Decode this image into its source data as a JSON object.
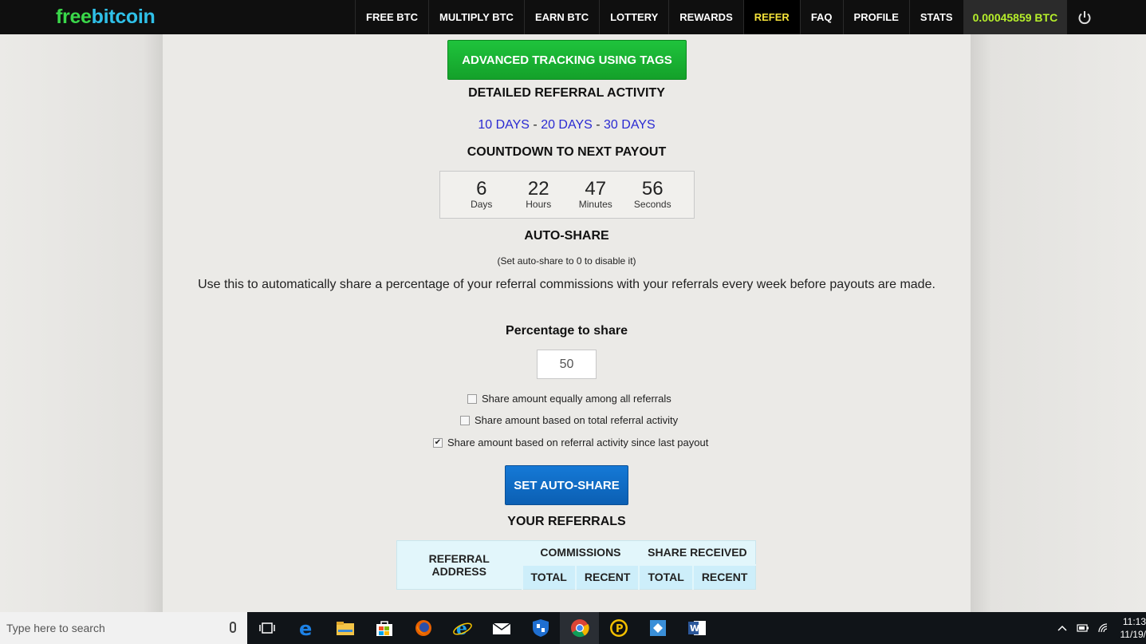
{
  "nav": {
    "logo_part1": "free",
    "logo_part2": "bitcoin",
    "items": [
      "FREE BTC",
      "MULTIPLY BTC",
      "EARN BTC",
      "LOTTERY",
      "REWARDS",
      "REFER",
      "FAQ",
      "PROFILE",
      "STATS"
    ],
    "active_item": "REFER",
    "balance": "0.00045859 BTC",
    "power_icon": "power-icon"
  },
  "tracking_button": "ADVANCED TRACKING USING TAGS",
  "detailed_activity": {
    "heading": "DETAILED REFERRAL ACTIVITY",
    "links": [
      "10 DAYS",
      "20 DAYS",
      "30 DAYS"
    ],
    "separator": " - "
  },
  "countdown": {
    "heading": "COUNTDOWN TO NEXT PAYOUT",
    "cells": [
      {
        "value": "6",
        "label": "Days"
      },
      {
        "value": "22",
        "label": "Hours"
      },
      {
        "value": "47",
        "label": "Minutes"
      },
      {
        "value": "56",
        "label": "Seconds"
      }
    ]
  },
  "autoshare": {
    "heading": "AUTO-SHARE",
    "note": "(Set auto-share to 0 to disable it)",
    "description": "Use this to automatically share a percentage of your referral commissions with your referrals every week before payouts are made.",
    "percentage_label": "Percentage to share",
    "percentage_value": "50",
    "options": [
      {
        "label": "Share amount equally among all referrals",
        "checked": false
      },
      {
        "label": "Share amount based on total referral activity",
        "checked": false
      },
      {
        "label": "Share amount based on referral activity since last payout",
        "checked": true
      }
    ],
    "submit": "SET AUTO-SHARE"
  },
  "referrals": {
    "heading": "YOUR REFERRALS",
    "col_address": "REFERRAL ADDRESS",
    "col_commissions": "COMMISSIONS",
    "col_share": "SHARE RECEIVED",
    "sub_total": "TOTAL",
    "sub_recent": "RECENT"
  },
  "taskbar": {
    "search_placeholder": "Type here to search",
    "apps": [
      "task-view-icon",
      "edge-icon",
      "file-explorer-icon",
      "store-icon",
      "firefox-icon",
      "internet-explorer-icon",
      "mail-icon",
      "defender-icon",
      "chrome-icon",
      "app-p-icon",
      "remote-desktop-icon",
      "word-icon"
    ],
    "active_app": "chrome-icon",
    "time": "11:13",
    "date": "11/19/"
  }
}
